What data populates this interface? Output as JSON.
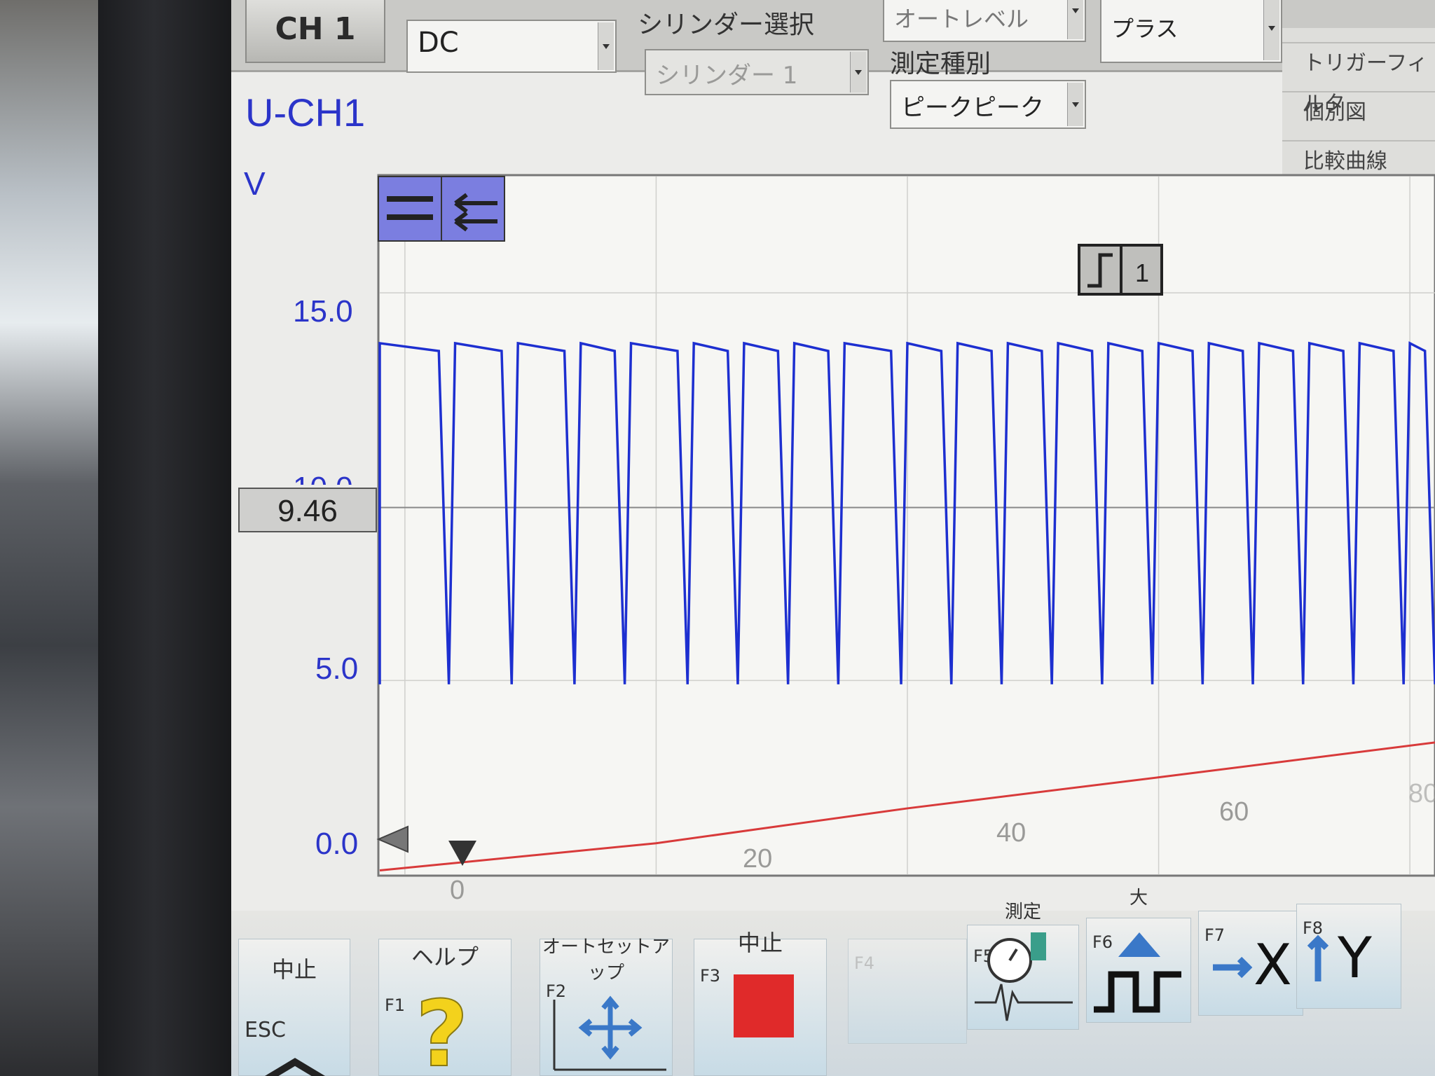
{
  "top": {
    "channel_button": "CH 1",
    "coupling_value": "DC",
    "cylinder_label": "シリンダー選択",
    "cylinder_value": "シリンダー 1",
    "measure_label": "測定種別",
    "measure_value": "ピークピーク",
    "mode_value": "オートレベル",
    "slope_value": "プラス"
  },
  "right_panel": {
    "items": [
      "トリガーフィルタ",
      "個別図",
      "比較曲線"
    ]
  },
  "plot": {
    "channel_title": "U-CH1",
    "unit": "V",
    "cursor_value": "9.46",
    "trigger_channel": "1"
  },
  "chart_data": {
    "type": "line",
    "ylabel": "V",
    "ylim": [
      0,
      18
    ],
    "xlim": [
      -2,
      82
    ],
    "y_ticks": [
      "15.0",
      "10.0",
      "5.0",
      "0.0"
    ],
    "x_ticks": [
      "0",
      "20",
      "40",
      "60",
      "80"
    ],
    "series": [
      {
        "color": "#1d2fd0",
        "style": "square pulse train",
        "high_level": 13.7,
        "low_level": 4.9,
        "pulse_x": [
          -2,
          4,
          9,
          14,
          18,
          23,
          27,
          31,
          35,
          40,
          44,
          48,
          52,
          56,
          60,
          64,
          68,
          72,
          76,
          80
        ]
      },
      {
        "color": "#d83a3a",
        "style": "slow ramp",
        "x": [
          -2,
          20,
          40,
          60,
          82
        ],
        "y": [
          0.1,
          0.8,
          1.7,
          2.5,
          3.4
        ]
      }
    ],
    "grid": true
  },
  "fkeys": [
    {
      "key": "ESC",
      "title": "中止"
    },
    {
      "key": "F1",
      "title": "ヘルプ"
    },
    {
      "key": "F2",
      "title": "オートセットアップ"
    },
    {
      "key": "F3",
      "title": "中止"
    },
    {
      "key": "F4",
      "title": ""
    },
    {
      "key": "F5",
      "title": "測定"
    },
    {
      "key": "F6",
      "title": "大"
    },
    {
      "key": "F7",
      "title": "X"
    },
    {
      "key": "F8",
      "title": "Y"
    }
  ],
  "colors": {
    "signal_blue": "#1d2fd0",
    "ramp_red": "#d83a3a",
    "axis_text_blue": "#2b34c9",
    "stop_red": "#e02a2a"
  }
}
